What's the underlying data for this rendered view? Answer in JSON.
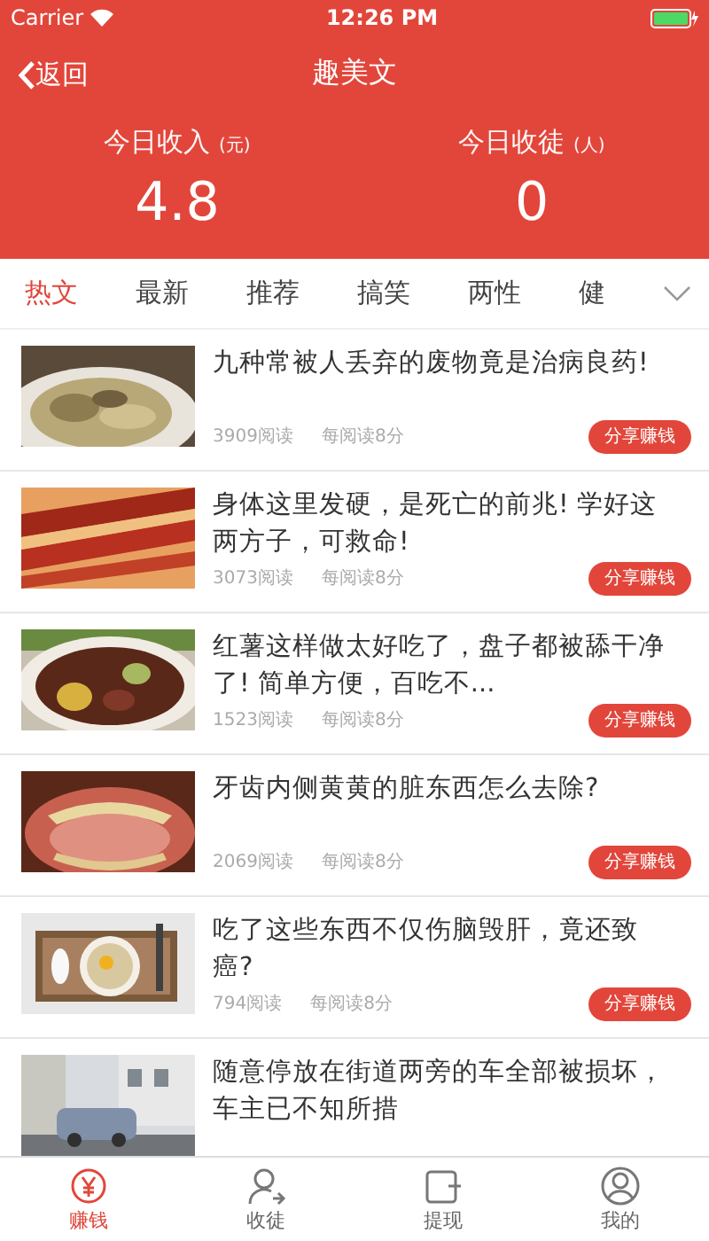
{
  "status_bar": {
    "carrier": "Carrier",
    "time": "12:26 PM"
  },
  "nav": {
    "back": "返回",
    "title": "趣美文"
  },
  "stats": [
    {
      "label": "今日收入",
      "unit": "(元)",
      "value": "4.8"
    },
    {
      "label": "今日收徒",
      "unit": "(人)",
      "value": "0"
    }
  ],
  "categories": [
    {
      "label": "热文",
      "selected": true
    },
    {
      "label": "最新",
      "selected": false
    },
    {
      "label": "推荐",
      "selected": false
    },
    {
      "label": "搞笑",
      "selected": false
    },
    {
      "label": "两性",
      "selected": false
    },
    {
      "label": "健",
      "selected": false
    }
  ],
  "articles": [
    {
      "title": "九种常被人丢弃的废物竟是治病良药!",
      "reads": "3909阅读",
      "reward": "每阅读8分",
      "button": "分享赚钱"
    },
    {
      "title": "身体这里发硬，是死亡的前兆! 学好这两方子，可救命!",
      "reads": "3073阅读",
      "reward": "每阅读8分",
      "button": "分享赚钱"
    },
    {
      "title": "红薯这样做太好吃了，盘子都被舔干净了! 简单方便，百吃不...",
      "reads": "1523阅读",
      "reward": "每阅读8分",
      "button": "分享赚钱"
    },
    {
      "title": "牙齿内侧黄黄的脏东西怎么去除?",
      "reads": "2069阅读",
      "reward": "每阅读8分",
      "button": "分享赚钱"
    },
    {
      "title": "吃了这些东西不仅伤脑毁肝，竟还致癌?",
      "reads": "794阅读",
      "reward": "每阅读8分",
      "button": "分享赚钱"
    },
    {
      "title": "随意停放在街道两旁的车全部被损坏，车主已不知所措"
    }
  ],
  "bottom_tabs": [
    {
      "label": "赚钱",
      "selected": true
    },
    {
      "label": "收徒",
      "selected": false
    },
    {
      "label": "提现",
      "selected": false
    },
    {
      "label": "我的",
      "selected": false
    }
  ]
}
